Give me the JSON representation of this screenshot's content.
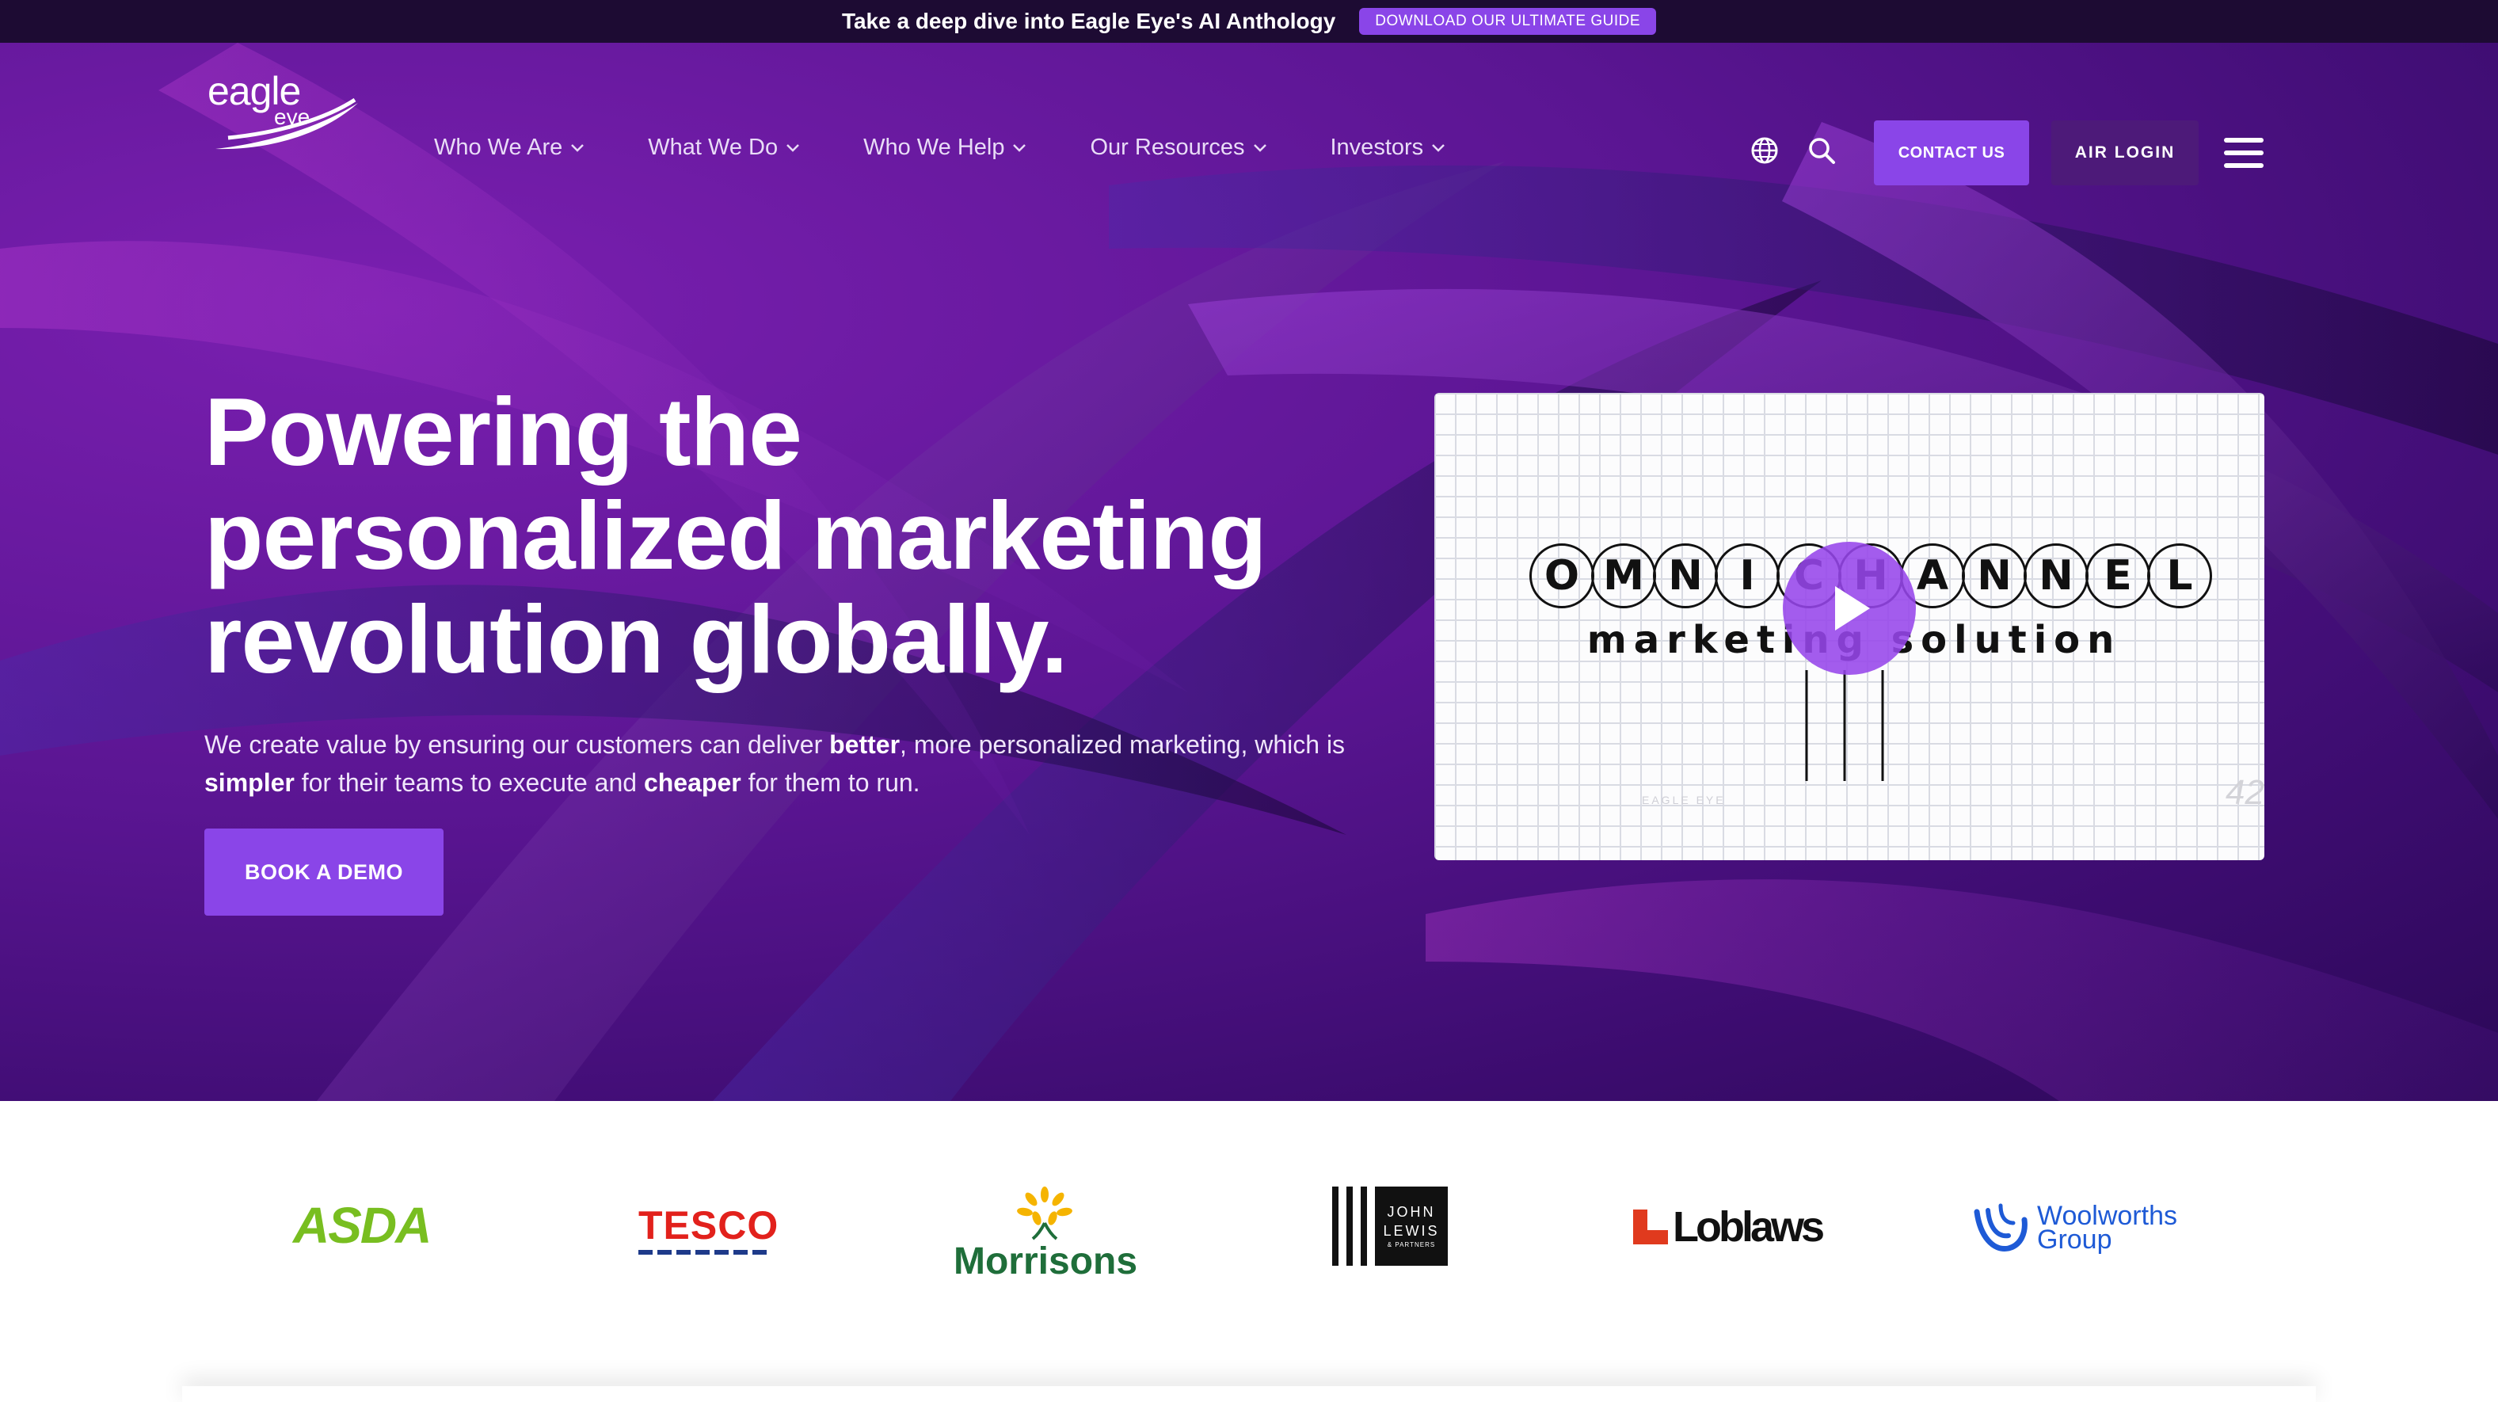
{
  "announcement": {
    "text": "Take a deep dive into Eagle Eye's AI Anthology",
    "button_label": "DOWNLOAD OUR ULTIMATE GUIDE"
  },
  "brand": {
    "logo_word": "eagle",
    "logo_sub": "eye"
  },
  "nav": {
    "items": [
      {
        "label": "Who We Are"
      },
      {
        "label": "What We Do"
      },
      {
        "label": "Who We Help"
      },
      {
        "label": "Our Resources"
      },
      {
        "label": "Investors"
      }
    ],
    "contact_label": "CONTACT US",
    "air_login_label": "AIR LOGIN",
    "icons": [
      "globe-icon",
      "search-icon",
      "hamburger-menu-icon"
    ]
  },
  "hero": {
    "headline_lines": [
      "Powering the",
      "personalized marketing",
      "revolution globally."
    ],
    "sub": {
      "p1": "We create value by ensuring our customers can deliver ",
      "b1": "better",
      "p2": ", more personalized marketing, which is ",
      "b2": "simpler",
      "p3": " for their teams to execute and ",
      "b3": "cheaper",
      "p4": " for them to run."
    },
    "cta_label": "BOOK A DEMO"
  },
  "video": {
    "letters": [
      "O",
      "M",
      "N",
      "I",
      "C",
      "H",
      "A",
      "N",
      "N",
      "E",
      "L"
    ],
    "caption": "marketing solution",
    "corner_number": "42",
    "watermark": "EAGLE EYE"
  },
  "client_logos": {
    "asda": "ASDA",
    "tesco": "TESCO",
    "morrisons": "Morrisons",
    "john_lewis": {
      "line1": "JOHN",
      "line2": "LEWIS",
      "line3": "& PARTNERS"
    },
    "loblaws": "Loblaws",
    "woolworths": {
      "line1": "Woolworths",
      "line2": "Group"
    }
  },
  "colors": {
    "accent": "#8a45e8",
    "top_bar": "#1d0b33",
    "hero_dark": "#3f0d73",
    "asda_green": "#78be20",
    "tesco_red": "#e2211c",
    "morrisons_green": "#1f6e3a",
    "woolworths_blue": "#1e5ad6"
  }
}
